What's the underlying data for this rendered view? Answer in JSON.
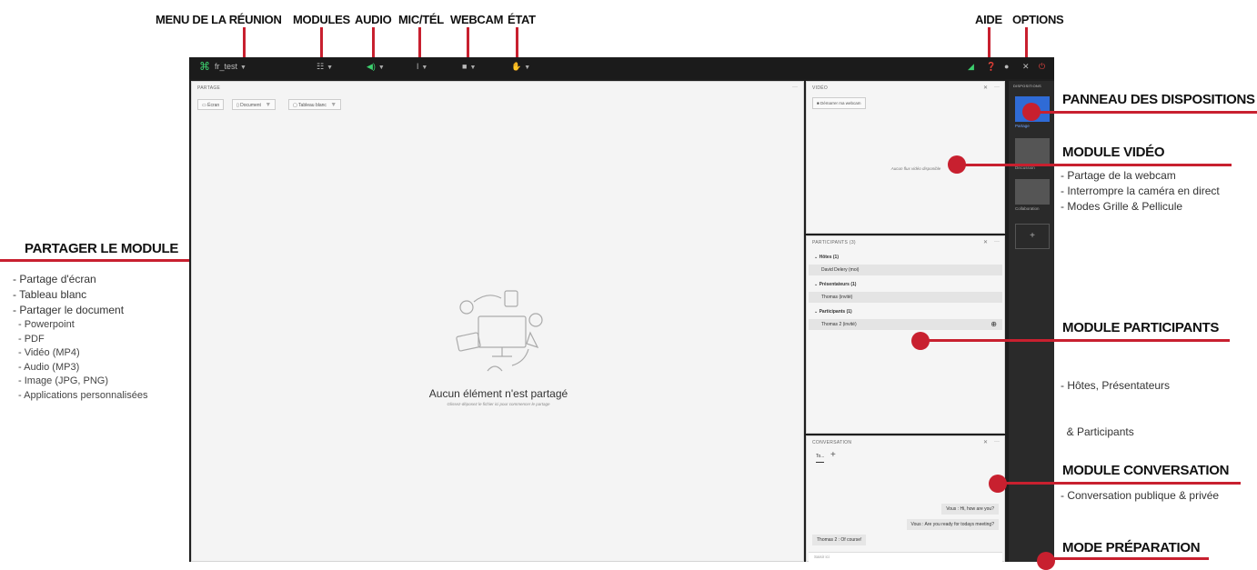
{
  "top_labels": {
    "menu": "MENU DE LA RÉUNION",
    "modules": "MODULES",
    "audio": "AUDIO",
    "mic": "MIC/TÉL",
    "webcam": "WEBCAM",
    "etat": "ÉTAT",
    "aide": "AIDE",
    "options": "OPTIONS"
  },
  "share_callout": {
    "title": "PARTAGER LE MODULE",
    "items": [
      "- Partage d'écran",
      "- Tableau blanc",
      "- Partager le document"
    ],
    "subitems": [
      "- Powerpoint",
      "- PDF",
      "- Vidéo (MP4)",
      "- Audio (MP3)",
      "- Image (JPG, PNG)",
      "- Applications personnalisées"
    ]
  },
  "callouts": {
    "layouts": {
      "title": "PANNEAU DES DISPOSITIONS"
    },
    "video": {
      "title": "MODULE VIDÉO",
      "items": [
        "- Partage de la webcam",
        "- Interrompre la caméra en direct",
        "- Modes Grille & Pellicule"
      ]
    },
    "participants": {
      "title": "MODULE PARTICIPANTS",
      "items": [
        "- Hôtes, Présentateurs",
        "  & Participants"
      ]
    },
    "chat": {
      "title": "MODULE CONVERSATION",
      "items": [
        "- Conversation publique & privée"
      ]
    },
    "prep": {
      "title": "MODE PRÉPARATION"
    }
  },
  "app": {
    "room_name": "fr_test",
    "share_panel": {
      "title": "PARTAGE",
      "tools": [
        "Écran",
        "Document",
        "Tableau blanc"
      ],
      "empty_title": "Aucun élément n'est partagé",
      "empty_hint": "Glissez-déposez le fichier ici pour commencer le partage"
    },
    "video_panel": {
      "title": "VIDÉO",
      "start_webcam": "Démarrer ma webcam",
      "no_video": "Aucun flux vidéo disponible"
    },
    "participants_panel": {
      "title": "PARTICIPANTS (3)",
      "groups": [
        {
          "label": "Hôtes (1)",
          "members": [
            "David Delery (moi)"
          ]
        },
        {
          "label": "Présentateurs (1)",
          "members": [
            "Thomas (invité)"
          ]
        },
        {
          "label": "Participants (1)",
          "members": [
            "Thomas 2 (invité)"
          ]
        }
      ]
    },
    "chat_panel": {
      "title": "CONVERSATION",
      "tab": "To...",
      "messages": [
        {
          "text": "Vous : Hi, how are you?"
        },
        {
          "text": "Vous : Are you ready for todays meeting?"
        },
        {
          "text": "Thomas 2 : Of course!"
        }
      ],
      "input_placeholder": "Saisir ici"
    },
    "layouts_panel": {
      "title": "DISPOSITIONS",
      "layouts": [
        "Partage",
        "Discussion",
        "Collaboration"
      ]
    },
    "colors": {
      "accent": "#c8202f",
      "layout_selected": "#2f6bd6",
      "app_bg": "#1e1e1e"
    }
  }
}
